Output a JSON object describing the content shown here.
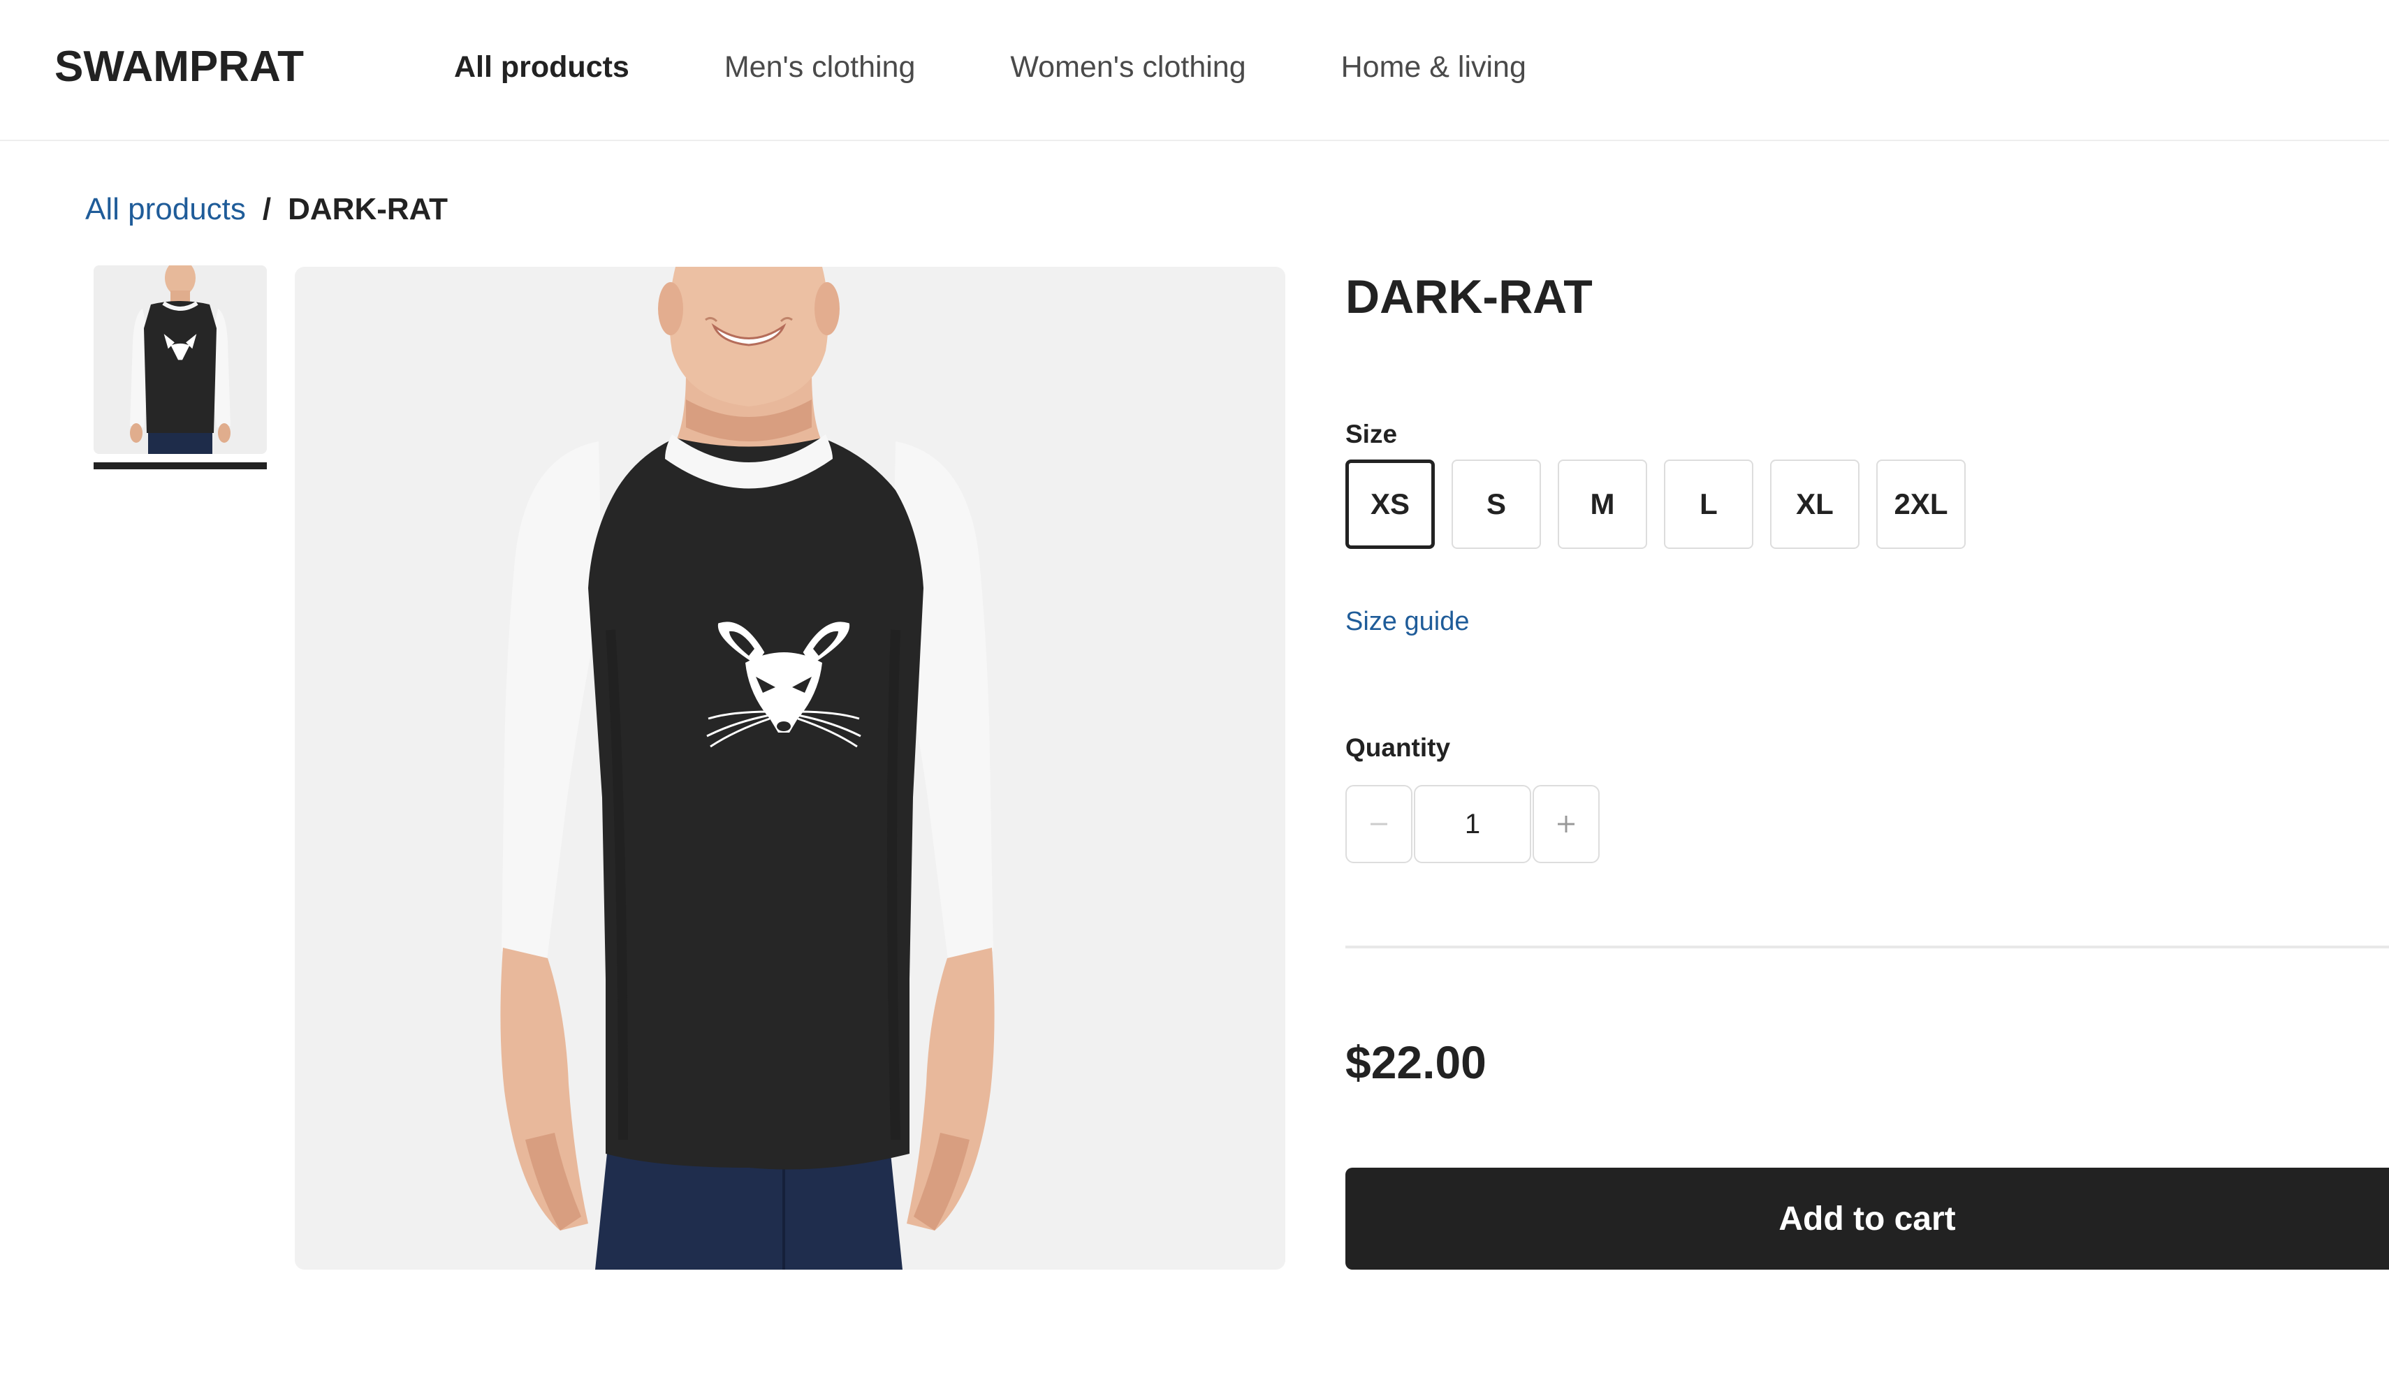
{
  "header": {
    "brand": "SWAMPRAT",
    "nav": [
      {
        "label": "All products",
        "active": true
      },
      {
        "label": "Men's clothing",
        "active": false
      },
      {
        "label": "Women's clothing",
        "active": false
      },
      {
        "label": "Home & living",
        "active": false
      }
    ]
  },
  "breadcrumb": {
    "parent": "All products",
    "separator": "/",
    "current": "DARK-RAT"
  },
  "gallery": {
    "image_subject": "man wearing black and white raglan shirt with white rat face print",
    "shirt_body_color": "#262626",
    "shirt_sleeve_color": "#f7f7f7",
    "background_color": "#f1f1f1",
    "thumbnail_count": 1,
    "selected_thumbnail": 1
  },
  "product": {
    "title": "DARK-RAT",
    "size_label": "Size",
    "sizes": [
      "XS",
      "S",
      "M",
      "L",
      "XL",
      "2XL"
    ],
    "selected_size": "XS",
    "size_guide": "Size guide",
    "quantity_label": "Quantity",
    "quantity": "1",
    "price": "$22.00",
    "add_to_cart": "Add to cart"
  },
  "colors": {
    "text": "#222222",
    "link": "#1f5c99",
    "button_bg": "#222222",
    "button_text": "#ffffff"
  }
}
